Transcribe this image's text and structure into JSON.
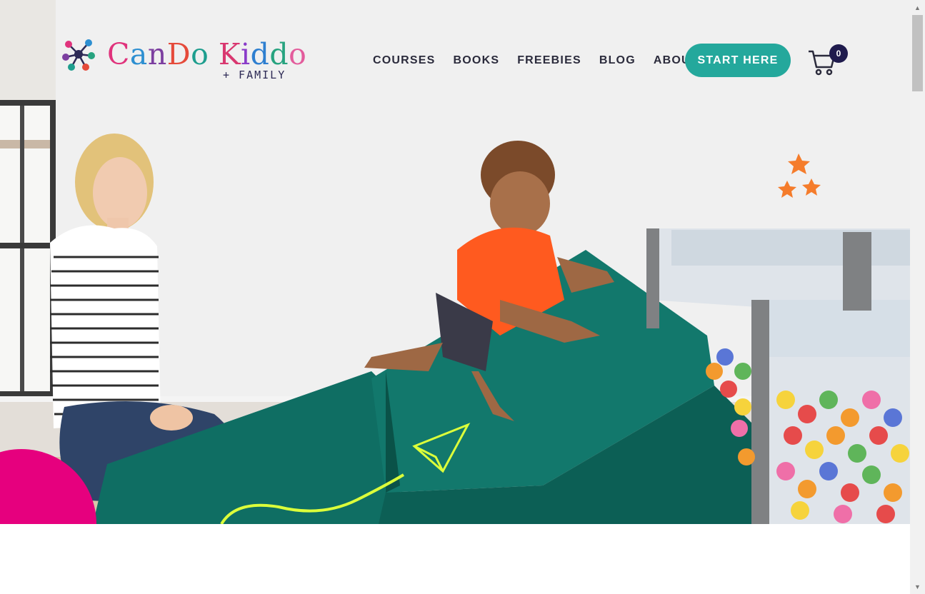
{
  "brand": {
    "name": "CanDo Kiddo",
    "sub": "+ FAMILY",
    "letter_colors": [
      "#e0337c",
      "#2d8fd1",
      "#7c3fa0",
      "#e54a3a",
      "#1e9e8e",
      "#d93870",
      "#8a3cc9",
      "#2e7fd0",
      "#27a37f",
      "#e35c9c",
      "#3b49a8"
    ]
  },
  "nav": {
    "items": [
      {
        "label": "COURSES"
      },
      {
        "label": "BOOKS"
      },
      {
        "label": "FREEBIES"
      },
      {
        "label": "BLOG"
      },
      {
        "label": "ABOUT"
      }
    ],
    "cta_label": "START HERE",
    "cart_count": "0"
  },
  "colors": {
    "accent_teal": "#24a89c",
    "navy": "#1f1b4d",
    "magenta": "#e6007e",
    "orange": "#f57c2b",
    "lime": "#dcff3a"
  },
  "icons": {
    "cart": "shopping-cart-icon",
    "logo_mark": "molecule-icon",
    "stars": "star-cluster-icon",
    "plane": "paper-plane-icon"
  },
  "scrollbar": {
    "up": "▲",
    "down": "▼"
  }
}
